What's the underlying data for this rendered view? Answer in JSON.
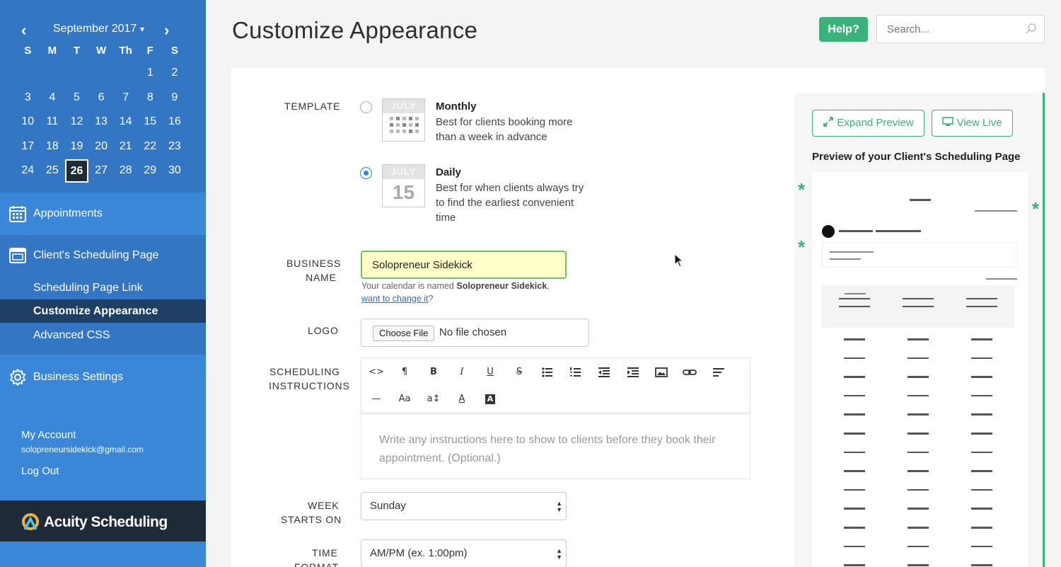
{
  "calendar": {
    "month_label": "September 2017",
    "prev": "‹",
    "next": "›",
    "caret": "▾",
    "dow": [
      "S",
      "M",
      "T",
      "W",
      "Th",
      "F",
      "S"
    ],
    "weeks": [
      [
        "",
        "",
        "",
        "",
        "",
        "1",
        "2"
      ],
      [
        "3",
        "4",
        "5",
        "6",
        "7",
        "8",
        "9"
      ],
      [
        "10",
        "11",
        "12",
        "13",
        "14",
        "15",
        "16"
      ],
      [
        "17",
        "18",
        "19",
        "20",
        "21",
        "22",
        "23"
      ],
      [
        "24",
        "25",
        "26",
        "27",
        "28",
        "29",
        "30"
      ]
    ],
    "today": "26"
  },
  "sidebar": {
    "appointments": "Appointments",
    "client_page": "Client's Scheduling Page",
    "sub": [
      "Scheduling Page Link",
      "Customize Appearance",
      "Advanced CSS"
    ],
    "active_sub": "Customize Appearance",
    "business_settings": "Business Settings",
    "my_account": "My Account",
    "email": "solopreneursidekick@gmail.com",
    "logout": "Log Out",
    "brand": "Acuity Scheduling"
  },
  "header": {
    "title": "Customize Appearance",
    "help": "Help?",
    "search_placeholder": "Search..."
  },
  "form": {
    "template_label": "TEMPLATE",
    "monthly": {
      "cal_month": "JULY",
      "title": "Monthly",
      "desc": "Best for clients booking more than a week in advance",
      "selected": false
    },
    "daily": {
      "cal_month": "JULY",
      "cal_day": "15",
      "title": "Daily",
      "desc": "Best for when clients always try to find the earliest convenient time",
      "selected": true
    },
    "business_label_1": "BUSINESS",
    "business_label_2": "NAME",
    "business_value": "Solopreneur Sidekick",
    "business_hint_1": "Your calendar is named ",
    "business_hint_bold": "Solopreneur Sidekick",
    "business_hint_2": ",",
    "business_hint_link": "want to change it",
    "business_hint_q": "?",
    "logo_label": "LOGO",
    "file_button": "Choose File",
    "file_status": "No file chosen",
    "instructions_label_1": "SCHEDULING",
    "instructions_label_2": "INSTRUCTIONS",
    "instructions_placeholder": "Write any instructions here to show to clients before they book their appointment. (Optional.)",
    "week_label_1": "WEEK",
    "week_label_2": "STARTS ON",
    "week_value": "Sunday",
    "time_label_1": "TIME",
    "time_label_2": "FORMAT",
    "time_value": "AM/PM (ex. 1:00pm)"
  },
  "toolbar": {
    "code": "<>",
    "paragraph": "¶",
    "bold": "B",
    "italic": "I",
    "underline": "U",
    "strike": "S",
    "hr": "—",
    "font_size": "Aa",
    "line_height": "a↕",
    "font_color": "A",
    "bg_color": "A"
  },
  "preview": {
    "expand": "Expand Preview",
    "view_live": "View Live",
    "title": "Preview of your Client's Scheduling Page",
    "star": "*"
  },
  "colors": {
    "sidebar": "#3a87d9",
    "sidebar_dark": "#3276c4",
    "accent_green": "#3bb27c",
    "brand_bg": "#1e2a38"
  }
}
